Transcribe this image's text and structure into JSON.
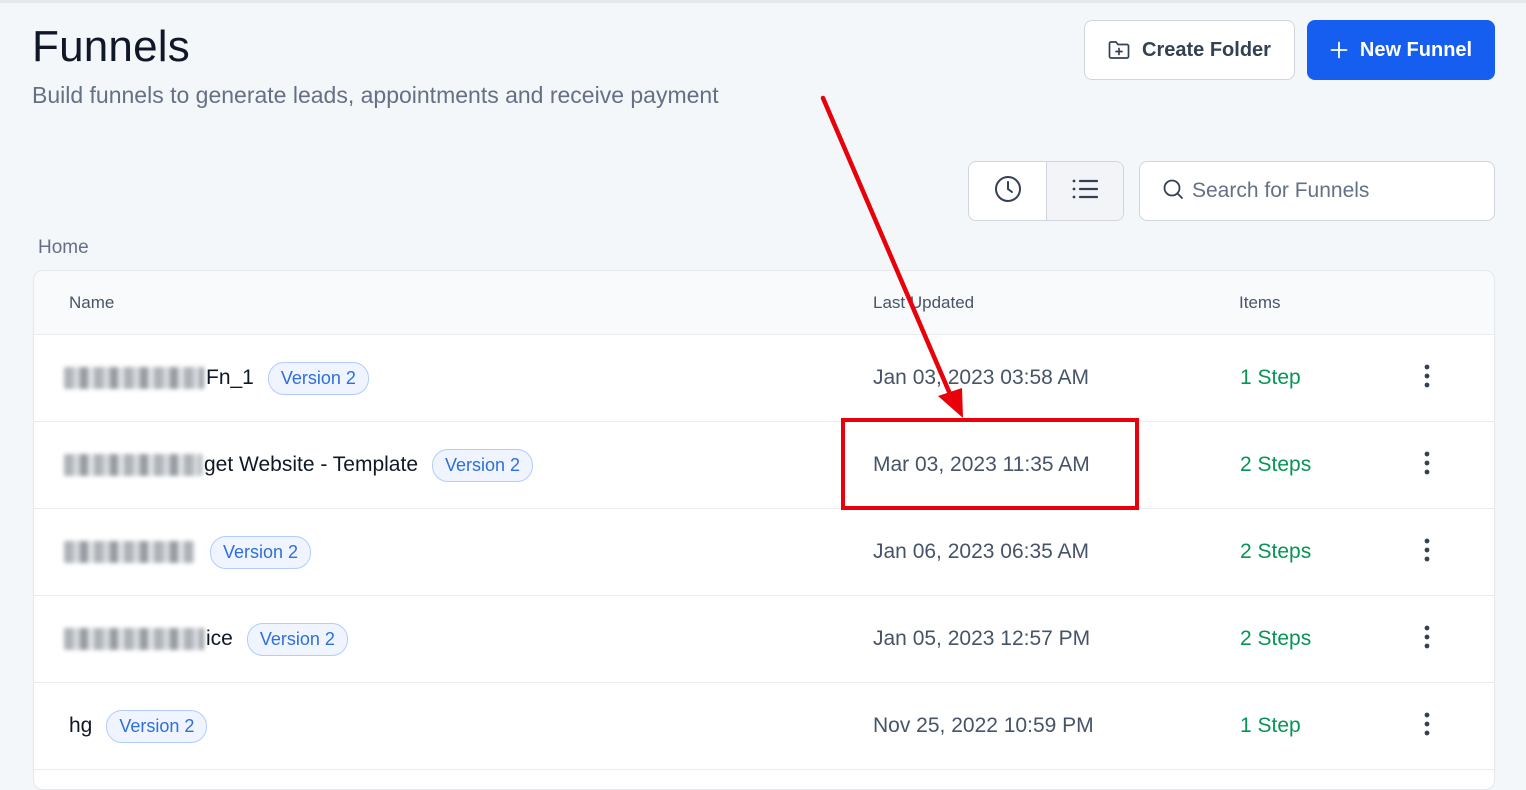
{
  "header": {
    "title": "Funnels",
    "subtitle": "Build funnels to generate leads, appointments and receive payment"
  },
  "actions": {
    "create_folder_label": "Create Folder",
    "new_funnel_label": "New Funnel"
  },
  "search": {
    "placeholder": "Search for Funnels"
  },
  "breadcrumb": "Home",
  "table": {
    "columns": [
      "Name",
      "Last Updated",
      "Items"
    ],
    "rows": [
      {
        "name": "Fn_1",
        "badge": "Version 2",
        "updated": "Jan 03, 2023 03:58 AM",
        "items": "1 Step"
      },
      {
        "name": "get Website - Template",
        "badge": "Version 2",
        "updated": "Mar 03, 2023 11:35 AM",
        "items": "2 Steps"
      },
      {
        "name": "",
        "badge": "Version 2",
        "updated": "Jan 06, 2023 06:35 AM",
        "items": "2 Steps"
      },
      {
        "name": "ice",
        "badge": "Version 2",
        "updated": "Jan 05, 2023 12:57 PM",
        "items": "2 Steps"
      },
      {
        "name": "hg",
        "badge": "Version 2",
        "updated": "Nov 25, 2022 10:59 PM",
        "items": "1 Step"
      }
    ]
  },
  "icons": {
    "create_folder": "folder-plus-icon",
    "new_funnel": "plus-icon",
    "recent_view": "clock-icon",
    "list_view": "list-icon",
    "search": "search-icon",
    "row_menu": "more-vertical-icon"
  },
  "colors": {
    "primary": "#155eef",
    "success_text": "#079455",
    "badge_text": "#2e6fd8",
    "annotation": "#e8000b"
  }
}
